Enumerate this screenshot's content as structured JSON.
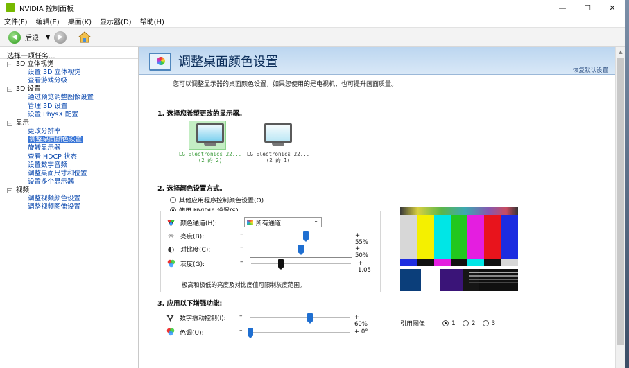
{
  "window": {
    "title": "NVIDIA 控制面板"
  },
  "menu": [
    "文件(F)",
    "编辑(E)",
    "桌面(K)",
    "显示器(D)",
    "帮助(H)"
  ],
  "toolbar": {
    "back_label": "后退"
  },
  "sidebar": {
    "header": "选择一项任务...",
    "tree": [
      {
        "label": "3D 立体视觉",
        "items": [
          "设置 3D 立体视觉",
          "查看游戏分级"
        ]
      },
      {
        "label": "3D 设置",
        "items": [
          "通过预览调整图像设置",
          "管理 3D 设置",
          "设置 PhysX 配置"
        ]
      },
      {
        "label": "显示",
        "items": [
          "更改分辨率",
          "调整桌面颜色设置",
          "旋转显示器",
          "查看 HDCP 状态",
          "设置数字音频",
          "调整桌面尺寸和位置",
          "设置多个显示器"
        ]
      },
      {
        "label": "视频",
        "items": [
          "调整视频颜色设置",
          "调整视频图像设置"
        ]
      }
    ],
    "selected": "调整桌面颜色设置"
  },
  "main": {
    "title": "调整桌面颜色设置",
    "restore_defaults": "恢复默认设置",
    "description": "您可以调整显示器的桌面颜色设置，如果您使用的是电视机，也可提升画面质量。",
    "section1": "1. 选择您希望更改的显示器。",
    "monitors": [
      {
        "name": "LG Electronics 22...",
        "sub": "(2 的 2)",
        "selected": true
      },
      {
        "name": "LG Electronics 22...",
        "sub": "(2 的 1)",
        "selected": false
      }
    ],
    "section2": "2. 选择颜色设置方式。",
    "radio_other_app": "其他应用程序控制颜色设置(O)",
    "radio_nvidia": "使用 NVIDIA 设置(S)",
    "color_channel_label": "颜色通道(H):",
    "color_channel_value": "所有通道",
    "brightness": {
      "label": "亮度(B):",
      "value_text": "55%",
      "value": 55
    },
    "contrast": {
      "label": "对比度(C):",
      "value_text": "50%",
      "value": 50
    },
    "gamma": {
      "label": "灰度(G):",
      "value_text": "1.05",
      "value": 1.05,
      "min": 0.3,
      "max": 2.8
    },
    "range_note": "极高和极低的亮度及对比度值可限制灰度范围。",
    "section3": "3. 应用以下增强功能:",
    "vibrance": {
      "label": "数字振动控制(I):",
      "value_text": "60%",
      "value": 60
    },
    "hue": {
      "label": "色调(U):",
      "value_text": "0°",
      "value": 0,
      "max": 359
    },
    "reference_image_label": "引用图像:",
    "reference_options": [
      "1",
      "2",
      "3"
    ],
    "reference_selected": "1"
  },
  "colors": {
    "nvidia_green": "#76b900",
    "selection_blue": "#3875d7",
    "slider_blue": "#1f6fd1",
    "test_bars": [
      "#d7d7d7",
      "#f4f000",
      "#00e6e6",
      "#22c71e",
      "#e41ee0",
      "#e8141c",
      "#1c2ce0"
    ]
  }
}
